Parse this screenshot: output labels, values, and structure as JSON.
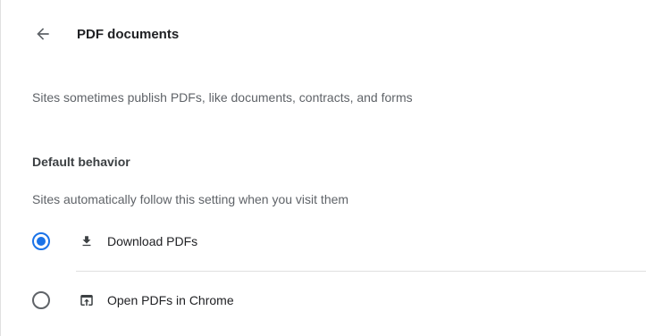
{
  "header": {
    "back_icon": "arrow-left-icon",
    "title": "PDF documents"
  },
  "description": "Sites sometimes publish PDFs, like documents, contracts, and forms",
  "default_behavior": {
    "heading": "Default behavior",
    "subtitle": "Sites automatically follow this setting when you visit them",
    "options": [
      {
        "label": "Download PDFs",
        "icon": "download-icon",
        "selected": true
      },
      {
        "label": "Open PDFs in Chrome",
        "icon": "open-in-browser-icon",
        "selected": false
      }
    ]
  },
  "colors": {
    "accent": "#1a73e8",
    "text_primary": "#202124",
    "text_secondary": "#5f6368",
    "divider": "#e0e0e0"
  }
}
